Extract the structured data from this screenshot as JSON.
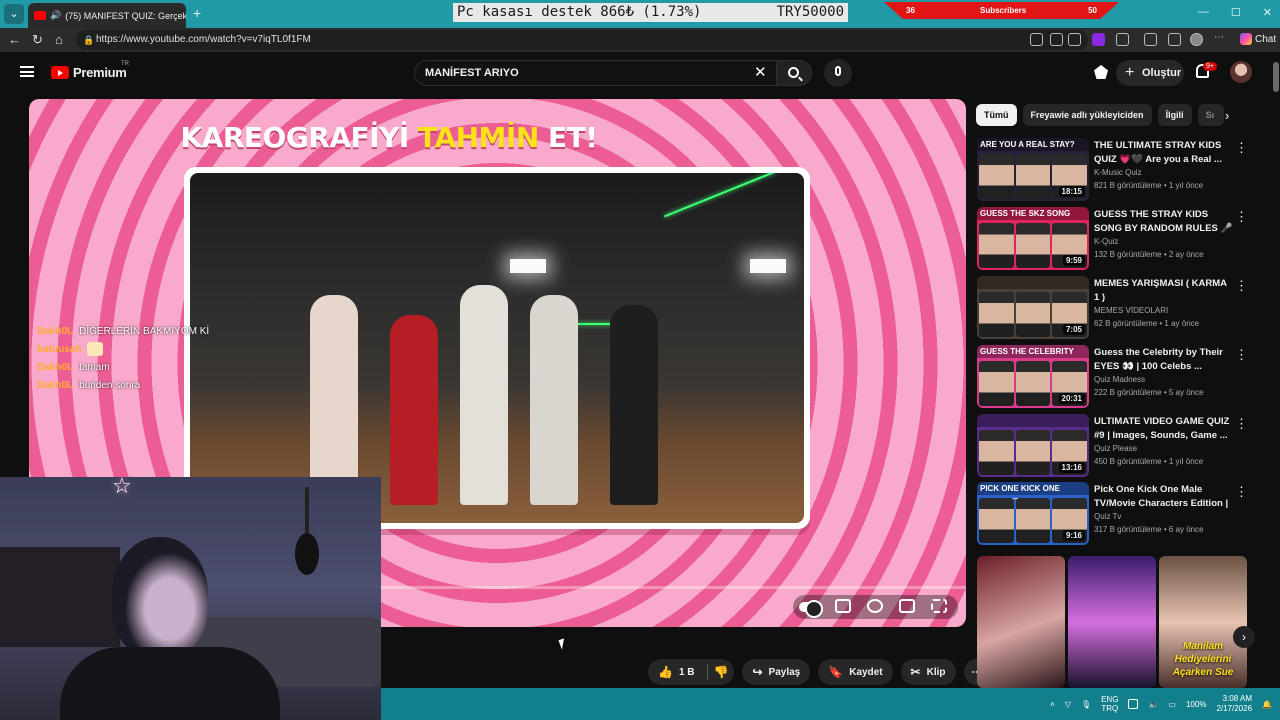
{
  "browser": {
    "tab_title": "(75) MANIFEST QUIZ: Gerçek",
    "url": "https://www.youtube.com/watch?v=v7iqTL0f1FM",
    "chat_label": "Chat"
  },
  "stream_overlay": {
    "ticker_left": "Pc kasası destek  866₺ (1.73%)",
    "ticker_right": "TRY50000",
    "subs_left": "36",
    "subs_label": "Subscribers",
    "subs_right": "50",
    "chat": [
      {
        "user": "Dalin0L",
        "msg": "DİĞERLERİN BAKMIYOM Kİ"
      },
      {
        "user": "batuusah",
        "msg": ""
      },
      {
        "user": "Dalin0L",
        "msg": "tamam"
      },
      {
        "user": "Dalin0L",
        "msg": "bunden sonra"
      }
    ]
  },
  "youtube": {
    "logo_text": "Premium",
    "country": "TR",
    "search_value": "MANİFEST ARIYO",
    "create_label": "Oluştur",
    "notif_badge": "9+"
  },
  "video": {
    "title_part1": "KAREOGRAFİYİ ",
    "title_highlight": "TAHMİN",
    "title_part2": " ET!",
    "likes": "1 B",
    "share_label": "Paylaş",
    "save_label": "Kaydet",
    "clip_label": "Klip"
  },
  "sidebar": {
    "chips": [
      "Tümü",
      "Freyawie adlı yükleyiciden",
      "İlgili",
      "Sı"
    ],
    "recommendations": [
      {
        "title": "THE ULTIMATE STRAY KIDS QUIZ 💗🖤 Are you a Real ...",
        "channel": "K-Music Quiz",
        "views": "821 B görüntüleme",
        "age": "1 yıl önce",
        "duration": "18:15",
        "banner": "ARE YOU A REAL STAY?",
        "color": "#2a1f3a"
      },
      {
        "title": "GUESS THE STRAY KIDS SONG BY RANDOM RULES 🎤🐺 | ...",
        "channel": "K-Quiz",
        "views": "132 B görüntüleme",
        "age": "2 ay önce",
        "duration": "9:59",
        "banner": "GUESS THE SKZ SONG",
        "color": "#e0245e"
      },
      {
        "title": "MEMES YARIŞMASI ( KARMA 1 )",
        "channel": "MEMES VİDEOLARI",
        "views": "62 B görüntüleme",
        "age": "1 ay önce",
        "duration": "7:05",
        "banner": "",
        "color": "#4a4038"
      },
      {
        "title": "Guess the Celebrity by Their EYES 👀 | 100 Celebs ...",
        "channel": "Quiz Madness",
        "views": "222 B görüntüleme",
        "age": "5 ay önce",
        "duration": "20:31",
        "banner": "GUESS THE CELEBRITY",
        "color": "#d93b8a"
      },
      {
        "title": "ULTIMATE VIDEO GAME QUIZ #9 | Images, Sounds, Game ...",
        "channel": "Quiz Please",
        "views": "450 B görüntüleme",
        "age": "1 yıl önce",
        "duration": "13:16",
        "banner": "",
        "color": "#5a2d8c"
      },
      {
        "title": "Pick One Kick One Male TV/Movie Characters Edition | ...",
        "channel": "Quiz Tv",
        "views": "317 B görüntüleme",
        "age": "6 ay önce",
        "duration": "9:16",
        "banner": "PICK ONE KICK ONE CHARACTER",
        "color": "#2b62c9"
      }
    ],
    "shorts_caption": "Manilam Hediyelerini Açarken Sue"
  },
  "taskbar": {
    "lang_top": "ENG",
    "lang_bottom": "TRQ",
    "battery": "100%",
    "time": "3:08 AM",
    "date": "2/17/2026"
  }
}
